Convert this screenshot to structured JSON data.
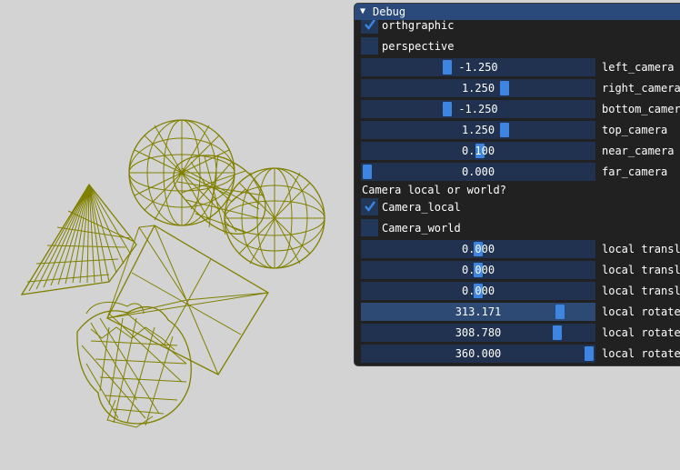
{
  "window": {
    "title": "Debug",
    "collapse_arrow": "▼"
  },
  "colors": {
    "background": "#d3d3d3",
    "wireframe": "#808000",
    "title_bar": "#294a7a",
    "slider_grab": "#3d85e0"
  },
  "projection": {
    "orthographic_label": "orthgraphic",
    "orthographic_checked": true,
    "perspective_label": "perspective",
    "perspective_checked": false
  },
  "camera_sliders": [
    {
      "label": "left_camera",
      "value": "-1.250",
      "fraction": 0.36
    },
    {
      "label": "right_camera",
      "value": "1.250",
      "fraction": 0.62
    },
    {
      "label": "bottom_camera",
      "value": "-1.250",
      "fraction": 0.36
    },
    {
      "label": "top_camera",
      "value": "1.250",
      "fraction": 0.62
    },
    {
      "label": "near_camera",
      "value": "0.100",
      "fraction": 0.51
    },
    {
      "label": "far_camera",
      "value": "0.000",
      "fraction": 0.0
    }
  ],
  "camera_mode": {
    "question": "Camera local or world?",
    "local_label": "Camera_local",
    "local_checked": true,
    "world_label": "Camera_world",
    "world_checked": false
  },
  "transform_sliders": [
    {
      "label": "local translate",
      "value": "0.000",
      "fraction": 0.5
    },
    {
      "label": "local translate",
      "value": "0.000",
      "fraction": 0.5
    },
    {
      "label": "local translate",
      "value": "0.000",
      "fraction": 0.5
    },
    {
      "label": "local rotate",
      "value": "313.171",
      "fraction": 0.87,
      "active": true
    },
    {
      "label": "local rotate",
      "value": "308.780",
      "fraction": 0.858
    },
    {
      "label": "local rotate",
      "value": "360.000",
      "fraction": 1.0
    }
  ]
}
